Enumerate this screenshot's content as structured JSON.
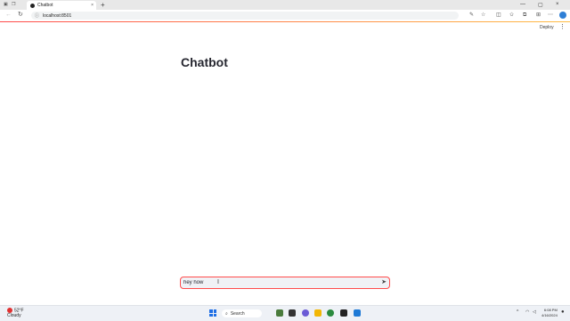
{
  "browser": {
    "tab_title": "Chatbot",
    "tab_close": "×",
    "new_tab": "+",
    "url": "localhost:8501",
    "window_controls": {
      "minimize": "—",
      "maximize": "▢",
      "close": "×"
    }
  },
  "toolbar": {
    "deploy_label": "Deploy",
    "menu": "⋮"
  },
  "main": {
    "title": "Chatbot"
  },
  "chat_input": {
    "value": "hey how",
    "send_icon": "send-icon"
  },
  "taskbar": {
    "weather_temp": "52°F",
    "weather_desc": "Cloudy",
    "search_label": "Search",
    "time": "6:08 PM",
    "date": "4/16/2024"
  },
  "colors": {
    "accent": "#ff4b4b",
    "title_text": "#262730"
  }
}
